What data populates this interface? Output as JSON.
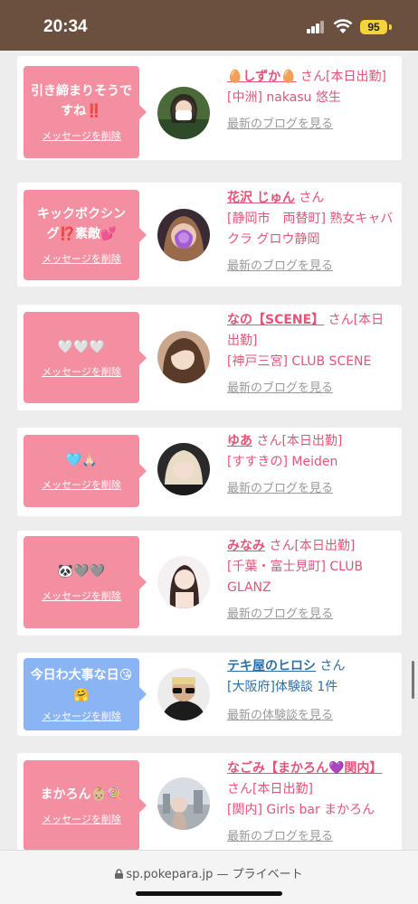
{
  "status": {
    "time": "20:34",
    "battery": "95"
  },
  "cards": [
    {
      "message": "引き締まりそうですね‼️",
      "delete": "メッセージを削除",
      "name": "🥚しずか🥚",
      "san": "さん",
      "tag": "[本日出勤]",
      "shop": "[中洲] nakasu 悠生",
      "link": "最新のブログを見る",
      "theme": "pink"
    },
    {
      "message": "キックボクシング⁉️素敵💕",
      "delete": "メッセージを削除",
      "name": "花沢 じゅん",
      "san": "さん",
      "tag": "",
      "shop": "[静岡市　両替町] 熟女キャバクラ グロウ静岡",
      "link": "最新のブログを見る",
      "theme": "pink"
    },
    {
      "message": "🤍🤍🤍",
      "delete": "メッセージを削除",
      "name": "なの【SCENE】",
      "san": "さん",
      "tag": "[本日出勤]",
      "shop": "[神戸三宮] CLUB SCENE",
      "link": "最新のブログを見る",
      "theme": "pink"
    },
    {
      "message": "🩵🙏🏻",
      "delete": "メッセージを削除",
      "name": "ゆあ",
      "san": "さん",
      "tag": "[本日出勤]",
      "shop": "[すすきの] Meiden",
      "link": "最新のブログを見る",
      "theme": "pink"
    },
    {
      "message": "🐼🩶🩶",
      "delete": "メッセージを削除",
      "name": "みなみ",
      "san": "さん",
      "tag": "[本日出勤]",
      "shop": "[千葉・富士見町] CLUB GLANZ",
      "link": "最新のブログを見る",
      "theme": "pink"
    },
    {
      "message": "今日わ大事な日😘🤗",
      "delete": "メッセージを削除",
      "name": "テキ屋のヒロシ",
      "san": "さん",
      "tag": "",
      "shop": "[大阪府]体験談 1件",
      "link": "最新の体験談を見る",
      "theme": "blue"
    },
    {
      "message": "まかろん👶🏼🍭",
      "delete": "メッセージを削除",
      "name": "なごみ【まかろん💜関内】",
      "san": "さん",
      "tag": "[本日出勤]",
      "shop": "[関内] Girls bar まかろん",
      "link": "最新のブログを見る",
      "theme": "pink"
    }
  ],
  "browser": {
    "url": "sp.pokepara.jp",
    "privacy": "— プライベート"
  },
  "colors": {
    "pink_bubble": "#f48fa1",
    "blue_bubble": "#8ab4f3",
    "name_pink": "#e25578",
    "name_blue": "#2f6fa8",
    "status_bar": "#6b5040"
  }
}
